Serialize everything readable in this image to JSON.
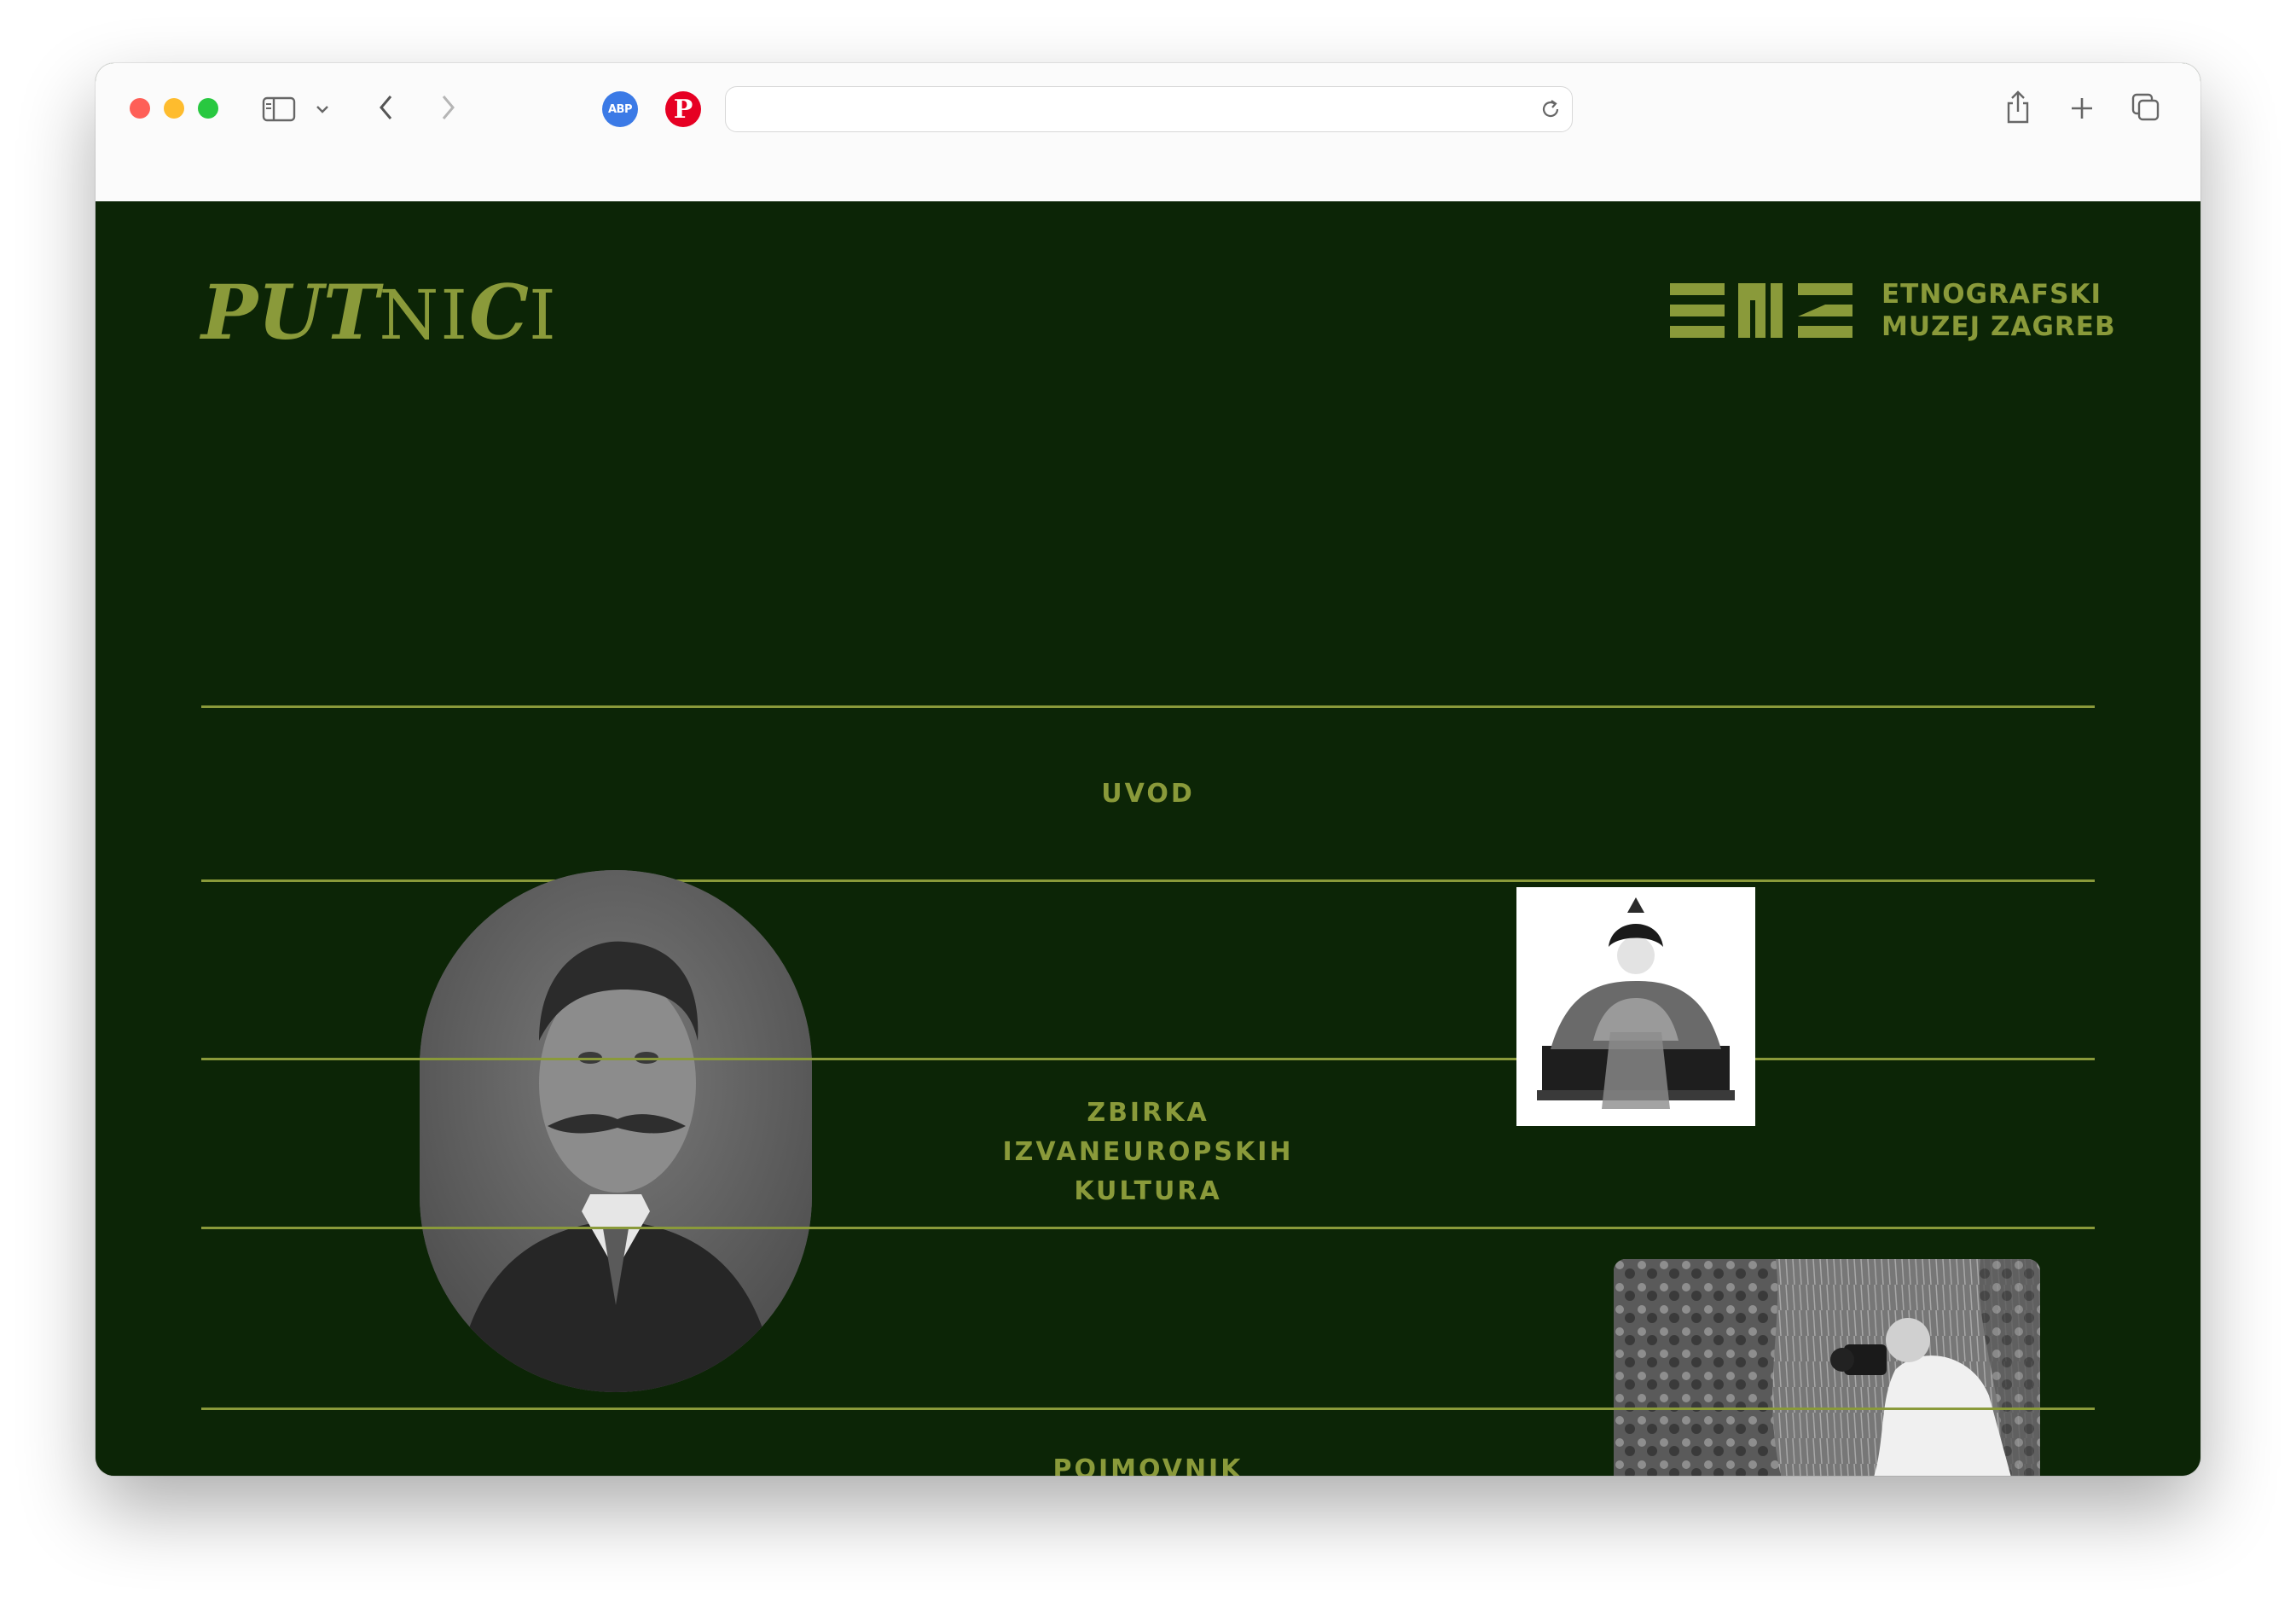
{
  "browser": {
    "address_value": "",
    "address_placeholder": "",
    "toolbar_icons": [
      "sidebar-icon",
      "chevron-down-icon",
      "back-icon",
      "forward-icon",
      "adblock-extension-icon",
      "pinterest-extension-icon",
      "reload-icon",
      "share-icon",
      "new-tab-icon",
      "tab-overview-icon"
    ],
    "extension_abp_label": "ABP",
    "extension_pinterest_label": "P"
  },
  "header": {
    "site_logo_text_bold_1": "PU",
    "site_logo_text_bold_2": "T",
    "site_logo_text_thin_1": "N",
    "site_logo_text_thin_2": "I",
    "site_logo_text_bold_3": "C",
    "site_logo_text_thin_3": "I",
    "museum_line_1": "ETNOGRAFSKI",
    "museum_line_2": "MUZEJ ZAGREB"
  },
  "nav": {
    "items": [
      {
        "label": "UVOD"
      },
      {
        "label_lines": [
          "ZBIRKA",
          "IZVANEUROPSKIH",
          "KULTURA"
        ]
      },
      {
        "label": "POJMOVNIK"
      }
    ]
  },
  "colors": {
    "page_background": "#0c2506",
    "accent_olive": "#8a9a3a",
    "toolbar_background": "#fbfbfb",
    "close": "#fe5f57",
    "minimize": "#febc2e",
    "zoom": "#28c840"
  }
}
